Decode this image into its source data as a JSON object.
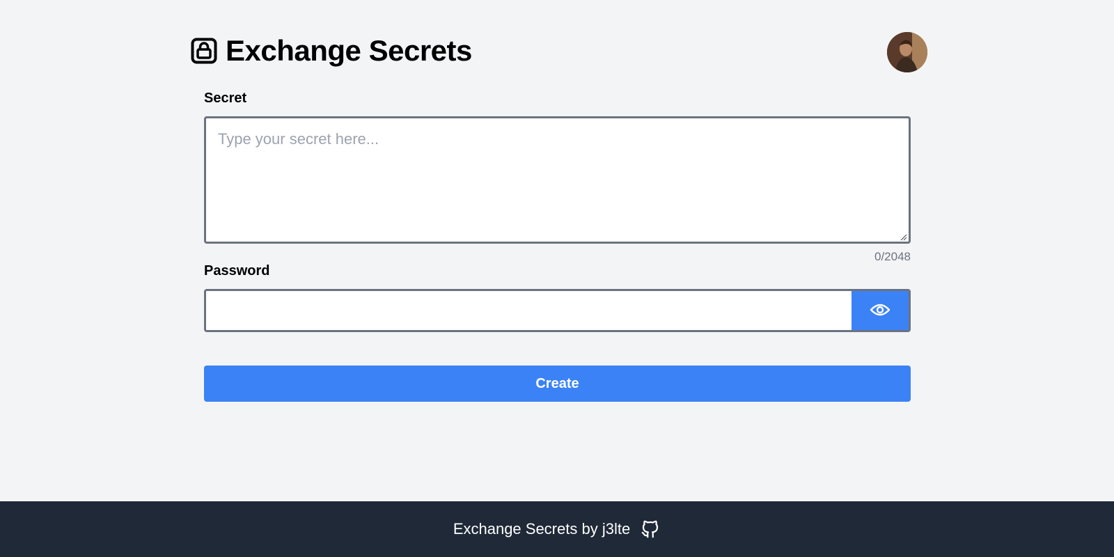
{
  "header": {
    "title": "Exchange Secrets",
    "lock_icon": "lock-icon",
    "avatar_alt": "user-avatar"
  },
  "form": {
    "secret_label": "Secret",
    "secret_placeholder": "Type your secret here...",
    "secret_value": "",
    "counter": "0/2048",
    "password_label": "Password",
    "password_value": "",
    "eye_icon": "eye-icon",
    "create_label": "Create"
  },
  "footer": {
    "text": "Exchange Secrets by j3lte",
    "github_icon": "github-icon"
  },
  "colors": {
    "background": "#f3f4f6",
    "accent": "#3b82f6",
    "border": "#6b7280",
    "footer_bg": "#1f2937",
    "muted_text": "#6b7280",
    "placeholder": "#9ca3af"
  }
}
